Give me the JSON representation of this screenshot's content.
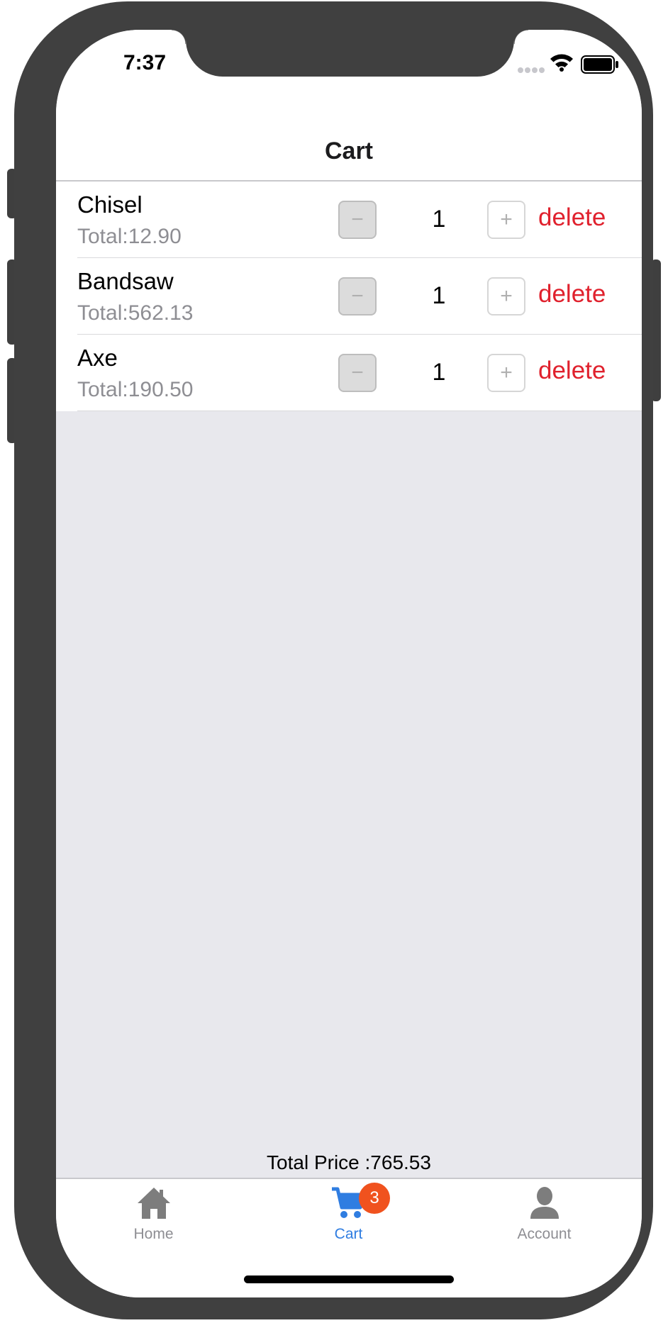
{
  "status_bar": {
    "time": "7:37",
    "icons": [
      "signal-icon",
      "wifi-icon",
      "battery-icon"
    ]
  },
  "nav": {
    "title": "Cart"
  },
  "cart": {
    "items": [
      {
        "name": "Chisel",
        "total": "Total:12.90",
        "quantity": "1",
        "minus_label": "−",
        "plus_label": "+",
        "delete_label": "delete"
      },
      {
        "name": "Bandsaw",
        "total": "Total:562.13",
        "quantity": "1",
        "minus_label": "−",
        "plus_label": "+",
        "delete_label": "delete"
      },
      {
        "name": "Axe",
        "total": "Total:190.50",
        "quantity": "1",
        "minus_label": "−",
        "plus_label": "+",
        "delete_label": "delete"
      }
    ]
  },
  "summary": {
    "total_price": "Total Price :765.53"
  },
  "tab_bar": {
    "tabs": [
      {
        "label": "Home",
        "icon": "home-icon",
        "active": false
      },
      {
        "label": "Cart",
        "icon": "cart-icon",
        "active": true,
        "badge": "3"
      },
      {
        "label": "Account",
        "icon": "person-icon",
        "active": false
      }
    ]
  },
  "colors": {
    "accent": "#2f7de1",
    "delete": "#e0212d",
    "badge": "#f0521e",
    "background": "#e8e8ed"
  }
}
